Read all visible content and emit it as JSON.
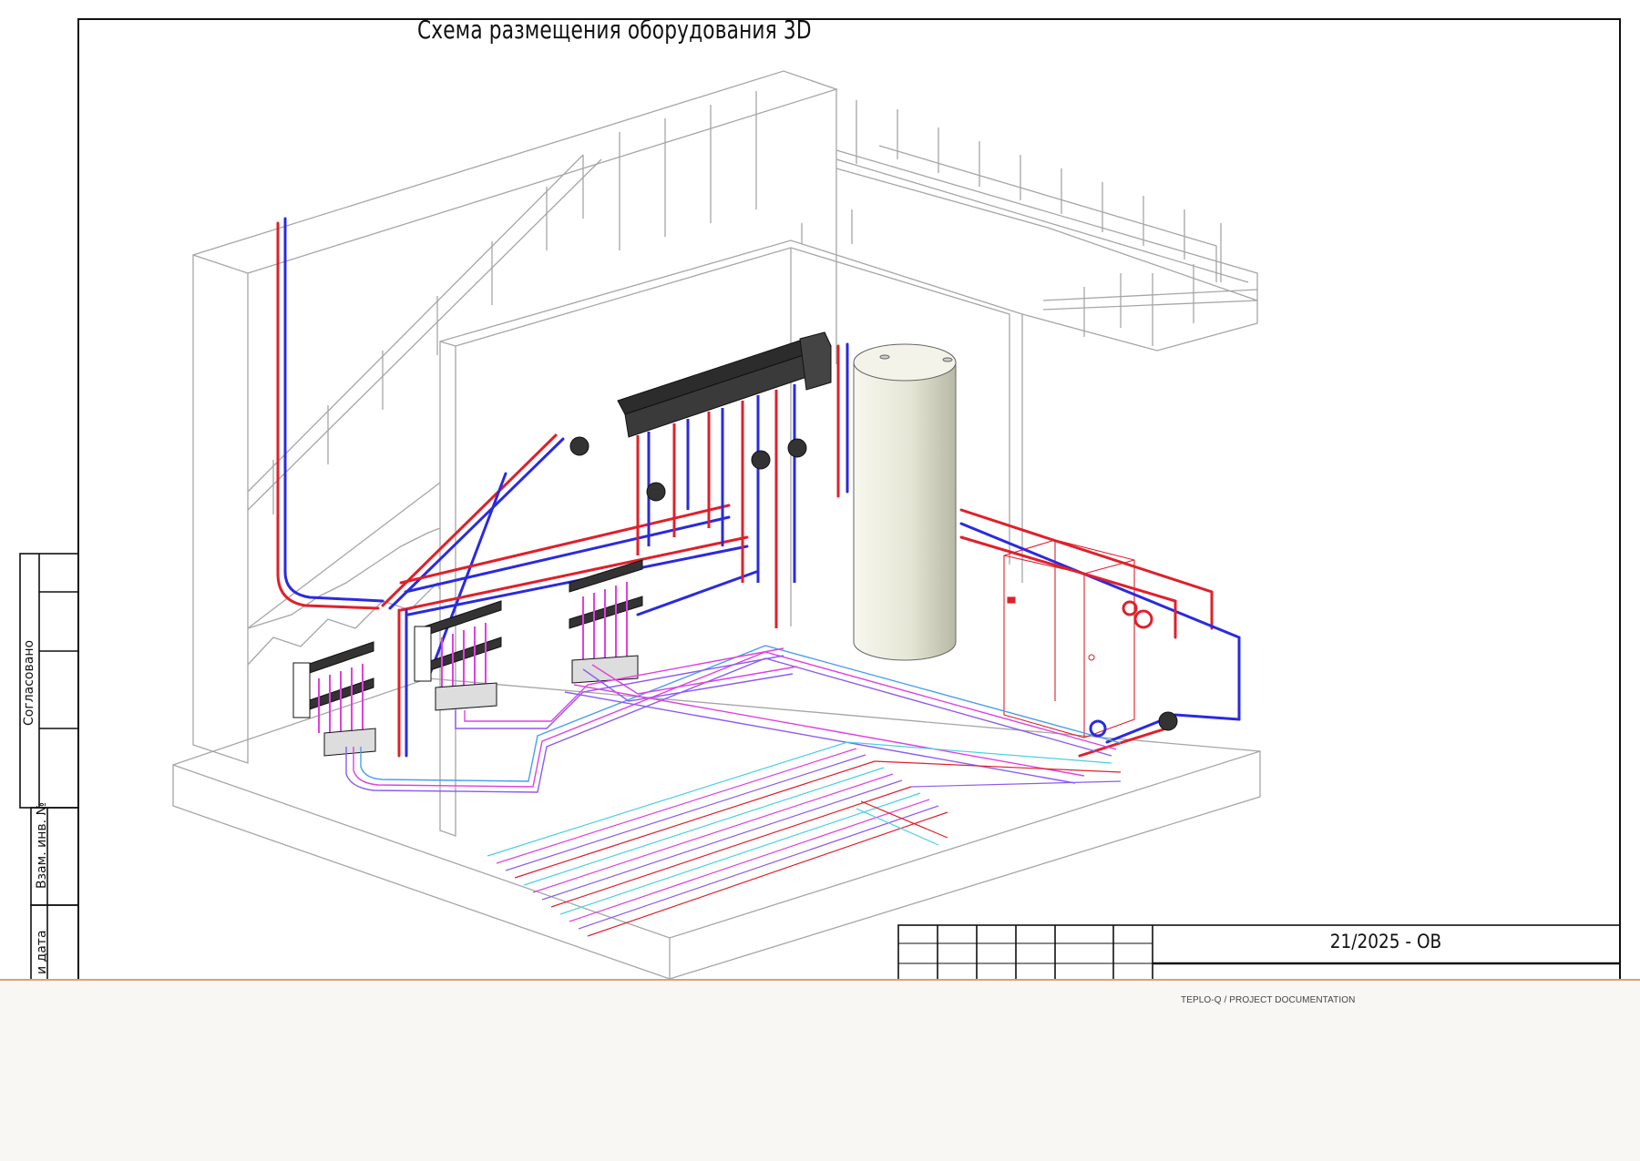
{
  "sheet": {
    "title": "Схема размещения оборудования 3D",
    "document_code": "21/2025 - ОВ"
  },
  "side_stamp": {
    "agreed_label": "Согласовано",
    "replaced_inv_label": "Взам. инв. №",
    "signature_date_label": "и дата"
  },
  "footer": {
    "brand_text": "TEPLO-Q / PROJECT DOCUMENTATION"
  },
  "colors": {
    "supply_pipe": "#e0202a",
    "return_pipe": "#2a2ae0",
    "floor_loop": "#8a5cf0",
    "floor_loop_alt": "#e040e0",
    "structure_lines": "#9a9a9a",
    "footer_accent": "#d9a46a"
  }
}
